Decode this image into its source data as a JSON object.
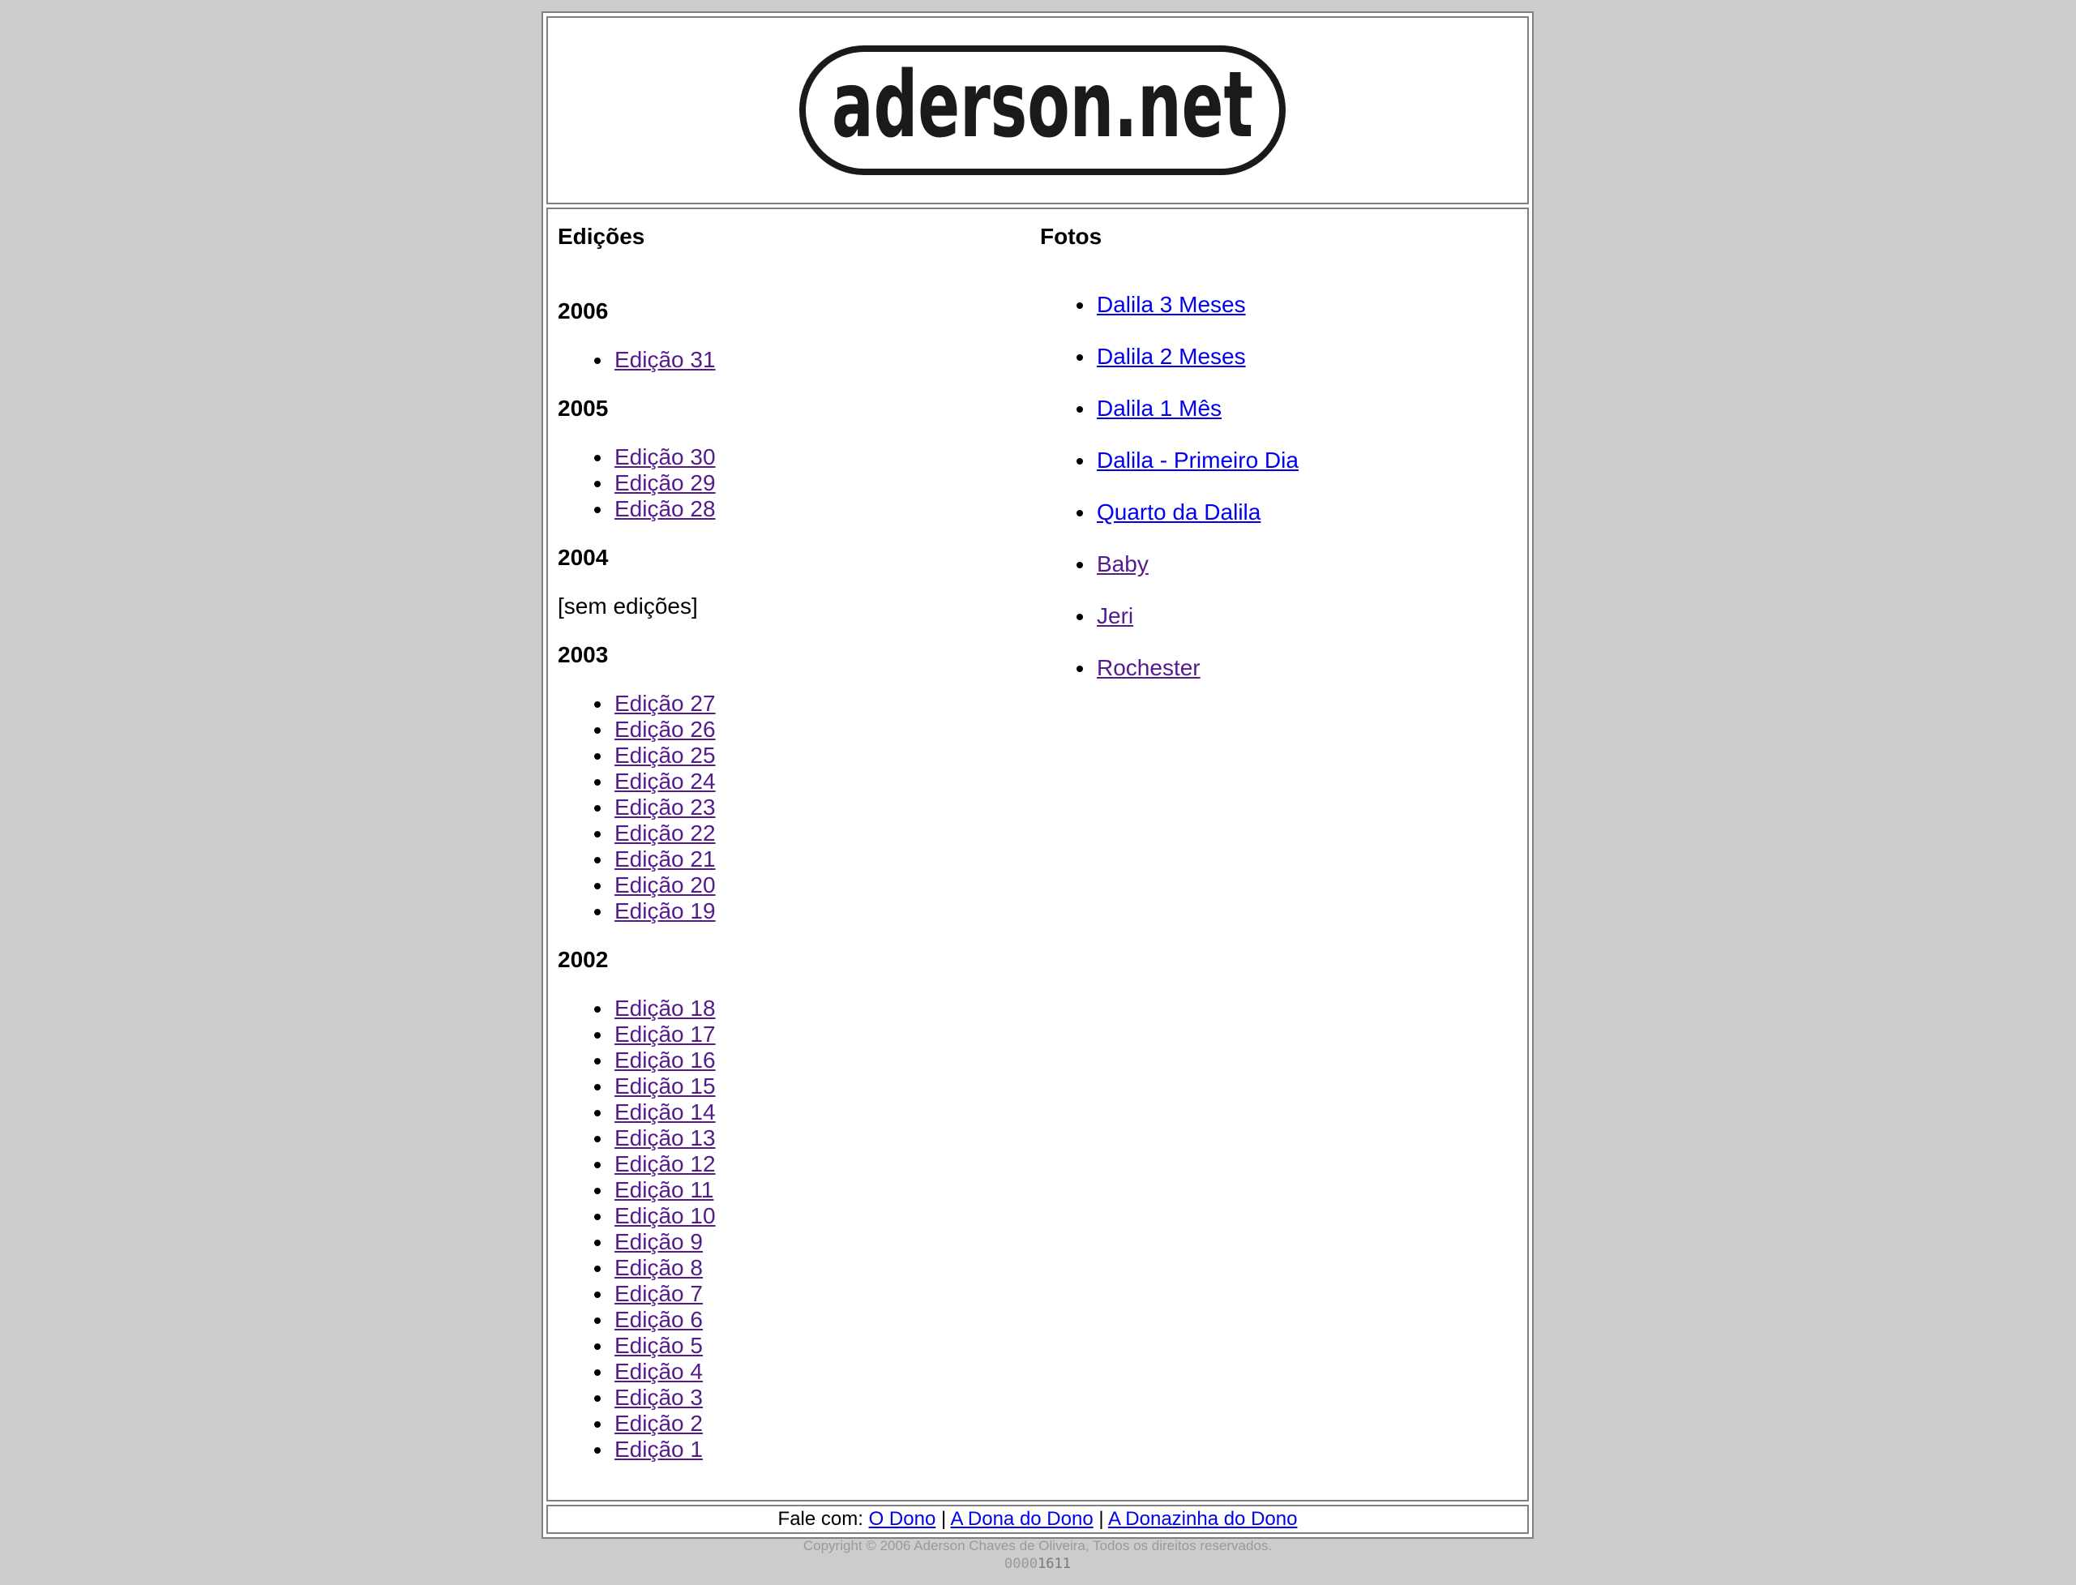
{
  "header": {
    "logo_text": "aderson.net"
  },
  "editions": {
    "heading": "Edições",
    "years": [
      {
        "year": "2006",
        "items": [
          "Edição 31"
        ]
      },
      {
        "year": "2005",
        "items": [
          "Edição 30",
          "Edição 29",
          "Edição 28"
        ]
      },
      {
        "year": "2004",
        "items": [],
        "empty_text": "[sem edições]"
      },
      {
        "year": "2003",
        "items": [
          "Edição 27",
          "Edição 26",
          "Edição 25",
          "Edição 24",
          "Edição 23",
          "Edição 22",
          "Edição 21",
          "Edição 20",
          "Edição 19"
        ]
      },
      {
        "year": "2002",
        "items": [
          "Edição 18",
          "Edição 17",
          "Edição 16",
          "Edição 15",
          "Edição 14",
          "Edição 13",
          "Edição 12",
          "Edição 11",
          "Edição 10",
          "Edição 9",
          "Edição 8",
          "Edição 7",
          "Edição 6",
          "Edição 5",
          "Edição 4",
          "Edição 3",
          "Edição 2",
          "Edição 1"
        ]
      }
    ]
  },
  "fotos": {
    "heading": "Fotos",
    "items": [
      {
        "label": "Dalila 3 Meses",
        "visited": false
      },
      {
        "label": "Dalila 2 Meses",
        "visited": false
      },
      {
        "label": "Dalila 1 Mês",
        "visited": false
      },
      {
        "label": "Dalila - Primeiro Dia",
        "visited": false
      },
      {
        "label": "Quarto da Dalila",
        "visited": false
      },
      {
        "label": "Baby",
        "visited": true
      },
      {
        "label": "Jeri",
        "visited": true
      },
      {
        "label": "Rochester",
        "visited": true
      }
    ]
  },
  "footer": {
    "prefix": "Fale com:",
    "separator": "|",
    "links": [
      "O Dono",
      "A Dona do Dono",
      "A Donazinha do Dono"
    ],
    "copyright": "Copyright © 2006 Aderson Chaves de Oliveira, Todos os direitos reservados.",
    "counter_prefix": "0000",
    "counter_value": "1611"
  },
  "colors": {
    "background": "#cccccc",
    "visited_link": "#551a8b",
    "unvisited_link": "#0000ee"
  }
}
